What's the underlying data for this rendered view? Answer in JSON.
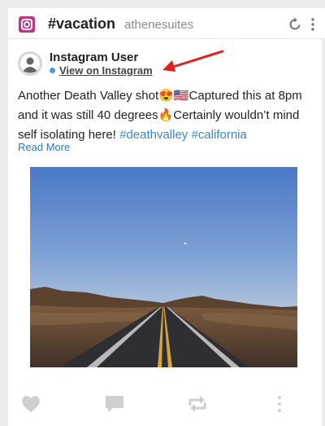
{
  "header": {
    "title": "#vacation",
    "subtitle": "athenesuites",
    "icons": [
      "instagram-logo",
      "refresh-icon",
      "more-vert-icon"
    ]
  },
  "post": {
    "user_name": "Instagram User",
    "view_link": "View on Instagram",
    "caption_text": "Another Death Valley shot😍🇺🇸Captured this at 8pm and it was still 40 degrees🔥Certainly wouldn’t mind self isolating here! ",
    "hashtag_1": "#deathvalley",
    "hashtag_2": "#california",
    "read_more": "Read More"
  },
  "actions": [
    "heart-icon",
    "comment-icon",
    "retweet-icon",
    "more-vert-icon"
  ],
  "colors": {
    "instagram": "#c13584",
    "link": "#3b86c4",
    "annotation_arrow": "#e02020",
    "action_icons": "#cfcfcf"
  }
}
